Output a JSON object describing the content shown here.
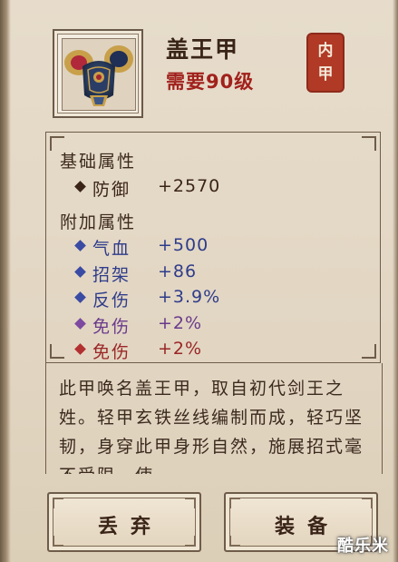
{
  "item": {
    "name": "盖王甲",
    "level_requirement": "需要90级",
    "slot_seal": [
      "内",
      "甲"
    ]
  },
  "base_attributes": {
    "title": "基础属性",
    "stats": [
      {
        "name": "防御",
        "value": "+2570",
        "color": "#3a2418",
        "diamond": "#3a2418"
      }
    ]
  },
  "extra_attributes": {
    "title": "附加属性",
    "stats": [
      {
        "name": "气血",
        "value": "+500",
        "color": "#2f3c8a",
        "diamond": "#3a4ba3"
      },
      {
        "name": "招架",
        "value": "+86",
        "color": "#2f3c8a",
        "diamond": "#3a4ba3"
      },
      {
        "name": "反伤",
        "value": "+3.9%",
        "color": "#2f3c8a",
        "diamond": "#3a4ba3"
      },
      {
        "name": "免伤",
        "value": "+2%",
        "color": "#6a3a8c",
        "diamond": "#7d4aa0"
      },
      {
        "name": "免伤",
        "value": "+2%",
        "color": "#9a2626",
        "diamond": "#b33030"
      }
    ]
  },
  "description": "此甲唤名盖王甲，取自初代剑王之姓。轻甲玄铁丝线编制而成，轻巧坚韧，身穿此甲身形自然，施展招式毫不受限，使",
  "buttons": {
    "discard": "丢弃",
    "equip": "装备"
  },
  "watermark": "酷乐米",
  "colors": {
    "level_text": "#a1211c",
    "seal_bg": "#b03a26"
  }
}
